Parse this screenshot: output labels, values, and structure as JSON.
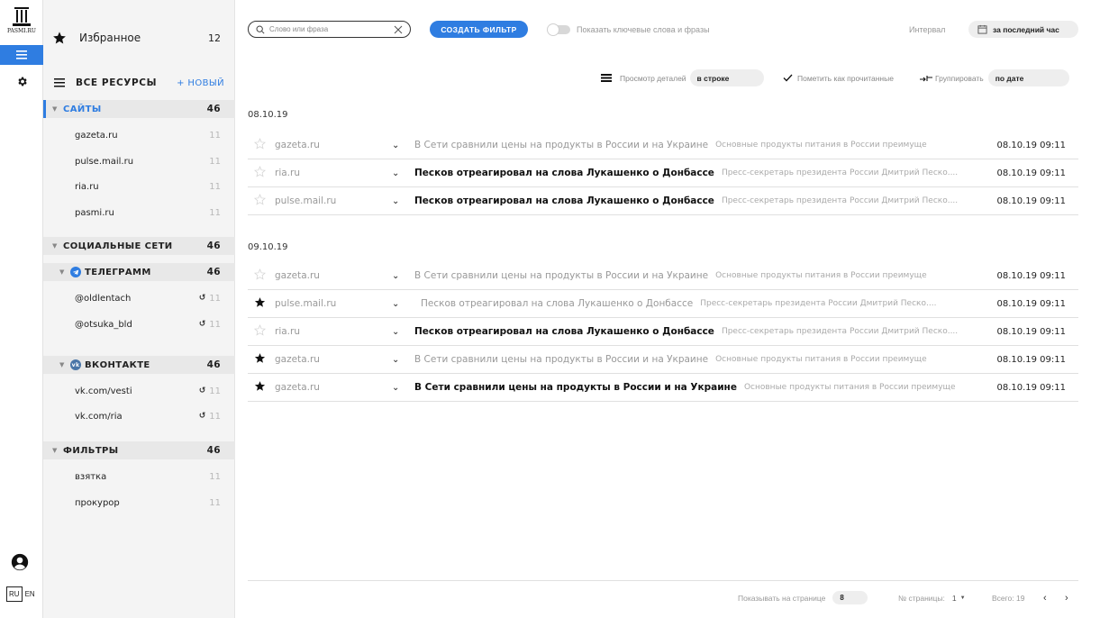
{
  "rail": {
    "logo_text": "PASMI.RU",
    "lang_active": "RU",
    "lang_other": "EN"
  },
  "sidebar": {
    "favorites": {
      "label": "Избранное",
      "count": "12"
    },
    "resources_title": "ВСЕ РЕСУРСЫ",
    "new_button": "+ НОВЫЙ",
    "groups": [
      {
        "label": "САЙТЫ",
        "count": "46",
        "items": [
          {
            "label": "gazeta.ru",
            "count": "11"
          },
          {
            "label": "pulse.mail.ru",
            "count": "11"
          },
          {
            "label": "ria.ru",
            "count": "11"
          },
          {
            "label": "pasmi.ru",
            "count": "11"
          }
        ]
      },
      {
        "label": "СОЦИАЛЬНЫЕ СЕТИ",
        "count": "46"
      },
      {
        "label": "ТЕЛЕГРАММ",
        "count": "46",
        "items": [
          {
            "label": "@oldlentach",
            "count": "11"
          },
          {
            "label": "@otsuka_bld",
            "count": "11"
          }
        ]
      },
      {
        "label": "ВКОНТАКТЕ",
        "count": "46",
        "items": [
          {
            "label": "vk.com/vesti",
            "count": "11"
          },
          {
            "label": "vk.com/ria",
            "count": "11"
          }
        ]
      },
      {
        "label": "ФИЛЬТРЫ",
        "count": "46",
        "items": [
          {
            "label": "взятка",
            "count": "11"
          },
          {
            "label": "прокурор",
            "count": "11"
          }
        ]
      }
    ]
  },
  "toolbar": {
    "search_placeholder": "Слово или фраза",
    "create_filter": "СОЗДАТЬ ФИЛЬТР",
    "show_keywords": "Показать ключевые слова и фразы",
    "interval_label": "Интервал",
    "interval_value": "за последний час",
    "view_details_label": "Просмотр деталей",
    "view_details_value": "в строке",
    "mark_read": "Пометить как прочитанные",
    "group_label": "Группировать",
    "group_value": "по дате"
  },
  "feed": {
    "sections": [
      {
        "date": "08.10.19",
        "rows": [
          {
            "starred": false,
            "source": "gazeta.ru",
            "title": "В Сети сравнили цены на продукты в России и на Украине",
            "bold": false,
            "snippet": "Основные продукты питания в России преимуще",
            "datetime": "08.10.19  09:11"
          },
          {
            "starred": false,
            "source": "ria.ru",
            "title": "Песков отреагировал на слова Лукашенко о Донбассе",
            "bold": true,
            "snippet": "Пресс-секретарь президента России Дмитрий Песко....",
            "datetime": "08.10.19  09:11"
          },
          {
            "starred": false,
            "source": "pulse.mail.ru",
            "title": "Песков отреагировал на слова Лукашенко о Донбассе",
            "bold": true,
            "snippet": "Пресс-секретарь президента России Дмитрий Песко....",
            "datetime": "08.10.19  09:11"
          }
        ]
      },
      {
        "date": "09.10.19",
        "rows": [
          {
            "starred": false,
            "source": "gazeta.ru",
            "title": "В Сети сравнили цены на продукты в России и на Украине",
            "bold": false,
            "snippet": "Основные продукты питания в России преимуще",
            "datetime": "08.10.19  09:11"
          },
          {
            "starred": true,
            "source": "pulse.mail.ru",
            "title": "Песков отреагировал на слова Лукашенко о Донбассе",
            "bold": false,
            "snippet": "Пресс-секретарь президента России Дмитрий Песко....",
            "datetime": "08.10.19  09:11"
          },
          {
            "starred": false,
            "source": "ria.ru",
            "title": "Песков отреагировал на слова Лукашенко о Донбассе",
            "bold": true,
            "snippet": "Пресс-секретарь президента России Дмитрий Песко....",
            "datetime": "08.10.19  09:11"
          },
          {
            "starred": true,
            "source": "gazeta.ru",
            "title": "В Сети сравнили цены на продукты в России и на Украине",
            "bold": false,
            "snippet": "Основные продукты питания в России преимуще",
            "datetime": "08.10.19  09:11"
          },
          {
            "starred": true,
            "source": "gazeta.ru",
            "title": "В Сети сравнили цены на продукты в России и на Украине",
            "bold": true,
            "snippet": "Основные продукты питания в России преимуще",
            "datetime": "08.10.19  09:11"
          }
        ]
      }
    ]
  },
  "pagination": {
    "per_page_label": "Показывать на странице",
    "per_page_value": "8",
    "page_label": "№ страницы:",
    "page_value": "1",
    "total": "Всего: 19"
  },
  "colors": {
    "accent": "#2f7de1",
    "sidebar_bg": "#f4f4f4",
    "telegram": "#2f7de1",
    "vk": "#4a76a8"
  }
}
